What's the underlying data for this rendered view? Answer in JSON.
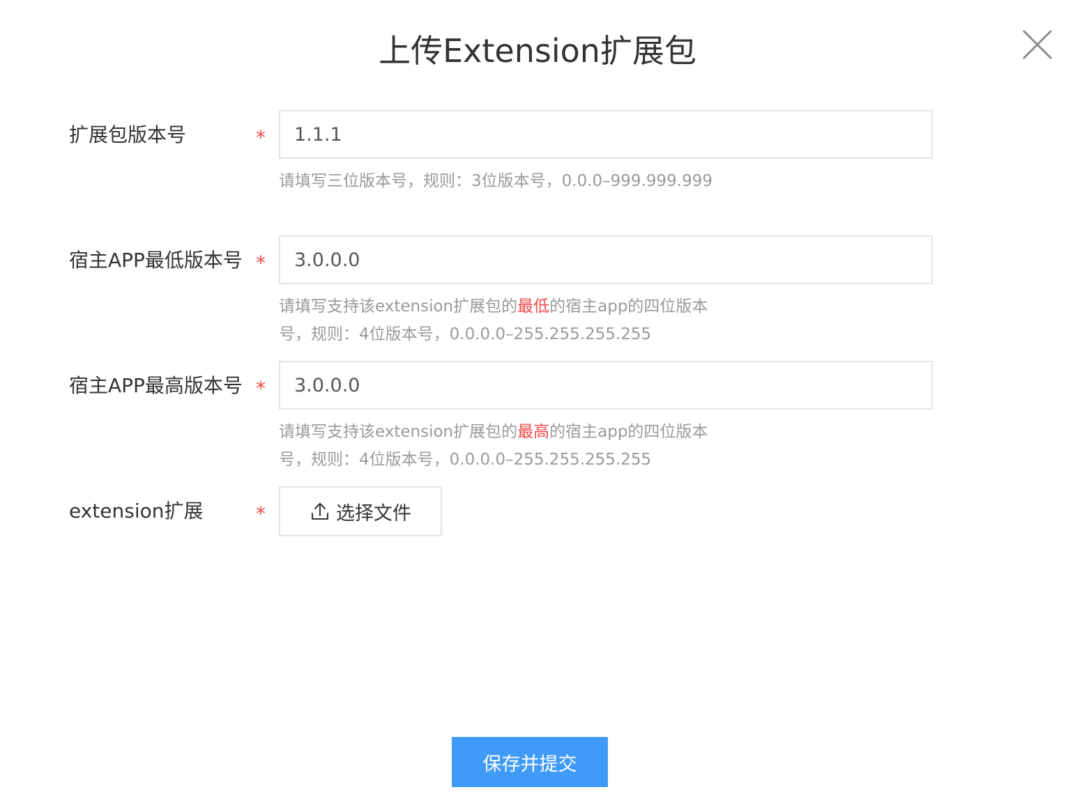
{
  "dialog": {
    "title": "上传Extension扩展包",
    "close_icon": "close-icon"
  },
  "form": {
    "version": {
      "label": "扩展包版本号",
      "required_mark": "*",
      "value": "1.1.1",
      "hint": "请填写三位版本号，规则：3位版本号，0.0.0–999.999.999"
    },
    "min_app": {
      "label": "宿主APP最低版本号",
      "required_mark": "*",
      "value": "3.0.0.0",
      "hint_prefix": "请填写支持该extension扩展包的",
      "hint_highlight": "最低",
      "hint_suffix": "的宿主app的四位版本号，规则：4位版本号，0.0.0.0–255.255.255.255"
    },
    "max_app": {
      "label": "宿主APP最高版本号",
      "required_mark": "*",
      "value": "3.0.0.0",
      "hint_prefix": "请填写支持该extension扩展包的",
      "hint_highlight": "最高",
      "hint_suffix": "的宿主app的四位版本号，规则：4位版本号，0.0.0.0–255.255.255.255"
    },
    "extension": {
      "label": "extension扩展",
      "required_mark": "*",
      "file_button_label": "选择文件",
      "file_button_icon": "upload-icon"
    }
  },
  "actions": {
    "submit_label": "保存并提交"
  },
  "colors": {
    "primary": "#3f9bf7",
    "required": "#f04a4a",
    "hint": "#9a9a9a",
    "border": "#e4e4e4"
  }
}
